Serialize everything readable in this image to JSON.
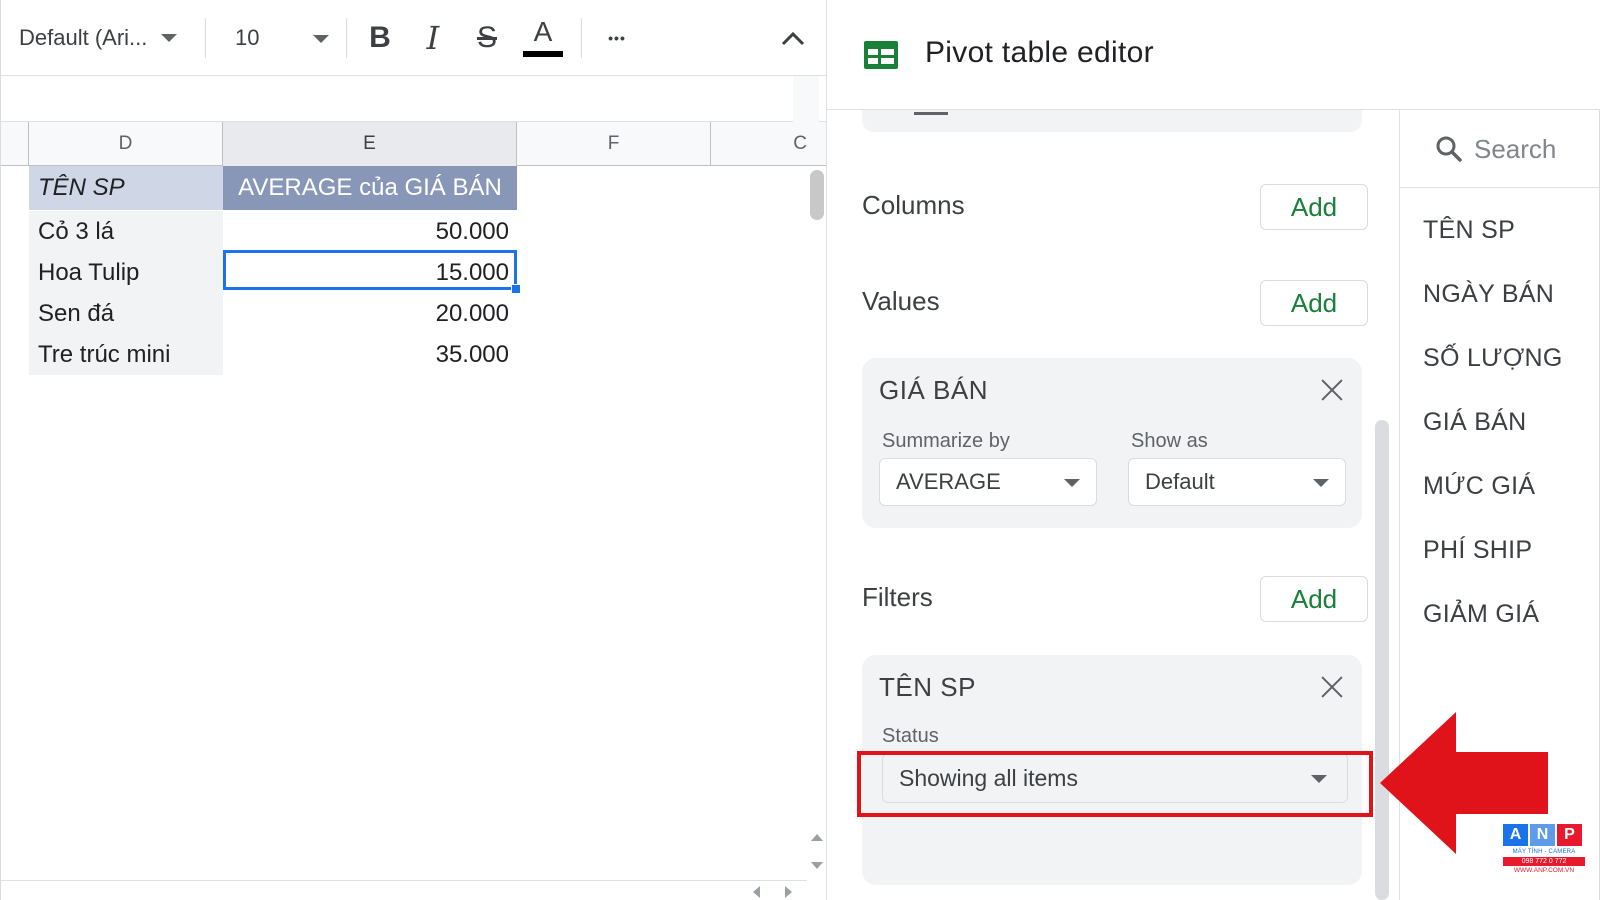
{
  "toolbar": {
    "font_name": "Default (Ari...",
    "font_size": "10",
    "bold_label": "B",
    "italic_label": "I",
    "strike_label": "S",
    "text_color_label": "A",
    "more_label": "•••"
  },
  "sheet": {
    "columns": [
      "D",
      "E",
      "F",
      "C"
    ],
    "pivot_header": {
      "row_label": "TÊN SP",
      "value_label": "AVERAGE của GIÁ BÁN"
    },
    "rows": [
      {
        "label": "Cỏ 3 lá",
        "value": "50.000"
      },
      {
        "label": "Hoa Tulip",
        "value": "15.000"
      },
      {
        "label": "Sen đá",
        "value": "20.000"
      },
      {
        "label": "Tre trúc mini",
        "value": "35.000"
      }
    ]
  },
  "editor": {
    "title": "Pivot table editor",
    "columns_label": "Columns",
    "values_label": "Values",
    "filters_label": "Filters",
    "add_label": "Add",
    "value_card": {
      "title": "GIÁ BÁN",
      "summarize_label": "Summarize by",
      "summarize_value": "AVERAGE",
      "show_as_label": "Show as",
      "show_as_value": "Default"
    },
    "filter_card": {
      "title": "TÊN SP",
      "status_label": "Status",
      "status_value": "Showing all items"
    }
  },
  "fields": {
    "search_placeholder": "Search",
    "items": [
      "TÊN SP",
      "NGÀY BÁN",
      "SỐ LƯỢNG",
      "GIÁ BÁN",
      "MỨC GIÁ",
      "PHÍ SHIP",
      "GIẢM GIÁ"
    ]
  },
  "watermark": {
    "letters": [
      "A",
      "N",
      "P"
    ],
    "subtitle": "MÁY TÍNH - CAMERA",
    "phone": "098 772 0 772",
    "site": "WWW.ANP.COM.VN"
  },
  "colors": {
    "add_green": "#188038",
    "highlight_red": "#e0121a",
    "pivot_header_blue": "#8897b7",
    "selection_blue": "#1a73e8"
  }
}
